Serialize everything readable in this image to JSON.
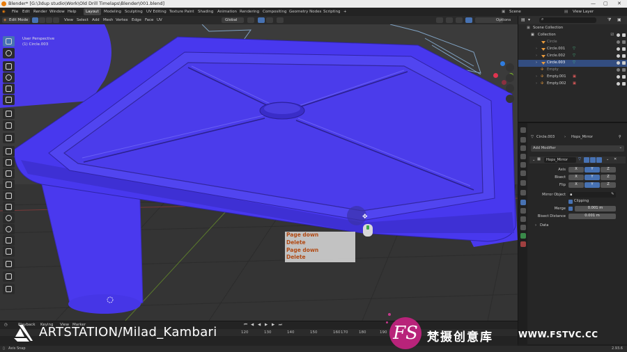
{
  "window": {
    "title": "Blender* [G:\\3dup studio\\Work\\Old Drill Timelaps\\Blender\\001.blend]"
  },
  "menu": {
    "items": [
      "File",
      "Edit",
      "Render",
      "Window",
      "Help"
    ],
    "workspaces": [
      "Layout",
      "Modeling",
      "Sculpting",
      "UV Editing",
      "Texture Paint",
      "Shading",
      "Animation",
      "Rendering",
      "Compositing",
      "Geometry Nodes",
      "Scripting"
    ],
    "add_tab": "+",
    "scene_label": "Scene",
    "view_layer_label": "View Layer"
  },
  "viewport_header": {
    "mode": "Edit Mode",
    "menus": [
      "View",
      "Select",
      "Add",
      "Mesh",
      "Vertex",
      "Edge",
      "Face",
      "UV"
    ],
    "orientation": "Global",
    "options": "Options"
  },
  "viewport": {
    "perspective": "User Perspective",
    "object": "(1) Circle.003"
  },
  "keystrokes": [
    "Page down",
    "Delete",
    "Page down",
    "Delete"
  ],
  "outliner": {
    "rows": [
      {
        "label": "Scene Collection"
      },
      {
        "label": "Collection"
      },
      {
        "label": "Circle"
      },
      {
        "label": "Circle.001"
      },
      {
        "label": "Circle.002"
      },
      {
        "label": "Circle.003"
      },
      {
        "label": "Empty"
      },
      {
        "label": "Empty.001"
      },
      {
        "label": "Empty.002"
      }
    ]
  },
  "properties": {
    "object_name": "Circle.003",
    "modifier_ref": "Hops_Mirror",
    "add_modifier": "Add Modifier",
    "modifier_name": "Hops_Mirror",
    "axis_label": "Axis",
    "bisect_label": "Bisect",
    "flip_label": "Flip",
    "x": "X",
    "y": "Y",
    "z": "Z",
    "mirror_object_label": "Mirror Object",
    "clipping_label": "Clipping",
    "merge_label": "Merge",
    "merge_value": "0.001 m",
    "bisect_distance_label": "Bisect Distance",
    "bisect_distance_value": "0.001 m",
    "data_label": "Data"
  },
  "timeline": {
    "playback": "Playback",
    "keying": "Keying",
    "view": "View",
    "marker": "Marker",
    "ticks": [
      "120",
      "130",
      "140",
      "150",
      "160",
      "170",
      "180",
      "190"
    ]
  },
  "statusbar": {
    "left": "Axis Snap",
    "version": "2.93.6"
  },
  "watermarks": {
    "artstation": "ARTSTATION/Milad_Kambari",
    "fs_logo": "FS",
    "fs_chinese": "梵摄创意库",
    "fs_url": "WWW.FSTVC.CC"
  },
  "colors": {
    "mesh": "#4a3cf2",
    "accent": "#4772b3",
    "keystroke_text": "#b14a14"
  }
}
